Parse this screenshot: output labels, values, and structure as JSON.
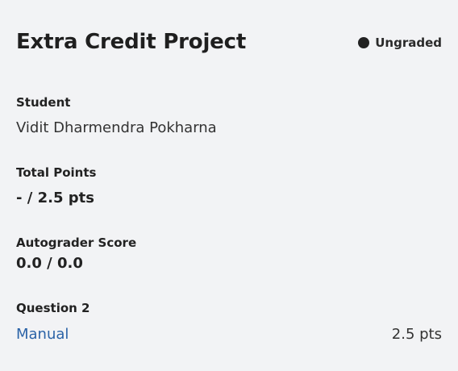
{
  "assignment": {
    "title": "Extra Credit Project",
    "status": "Ungraded"
  },
  "student": {
    "label": "Student",
    "name": "Vidit Dharmendra Pokharna"
  },
  "total_points": {
    "label": "Total Points",
    "value": "- / 2.5 pts"
  },
  "autograder": {
    "label": "Autograder Score",
    "value": "0.0 / 0.0"
  },
  "question": {
    "label": "Question 2",
    "link_text": "Manual",
    "points": "2.5 pts"
  }
}
